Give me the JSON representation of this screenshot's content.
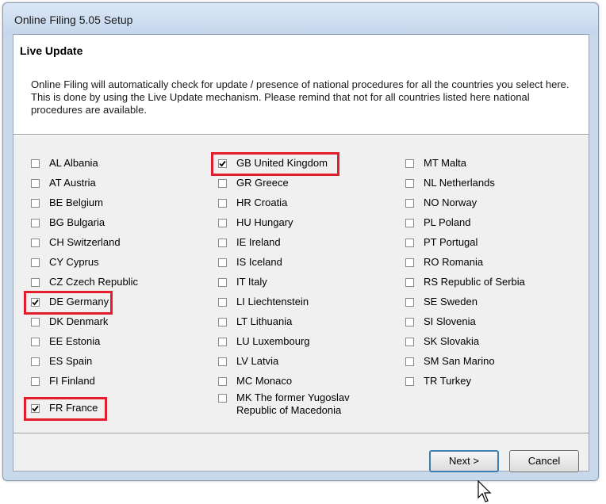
{
  "window": {
    "title": "Online Filing 5.05 Setup"
  },
  "header": {
    "title": "Live Update",
    "description": "Online Filing will automatically check for update / presence of national procedures for all the countries you select here. This is done by using the Live Update mechanism. Please remind that not for all countries listed here national procedures are available."
  },
  "countries": {
    "col1": [
      {
        "label": "AL Albania",
        "checked": false
      },
      {
        "label": "AT Austria",
        "checked": false
      },
      {
        "label": "BE Belgium",
        "checked": false
      },
      {
        "label": "BG Bulgaria",
        "checked": false
      },
      {
        "label": "CH Switzerland",
        "checked": false
      },
      {
        "label": "CY Cyprus",
        "checked": false
      },
      {
        "label": "CZ Czech Republic",
        "checked": false
      },
      {
        "label": "DE Germany",
        "checked": true
      },
      {
        "label": "DK Denmark",
        "checked": false
      },
      {
        "label": "EE Estonia",
        "checked": false
      },
      {
        "label": "ES Spain",
        "checked": false
      },
      {
        "label": "FI Finland",
        "checked": false
      },
      {
        "label": "FR France",
        "checked": true
      }
    ],
    "col2": [
      {
        "label": "GB United Kingdom",
        "checked": true
      },
      {
        "label": "GR Greece",
        "checked": false
      },
      {
        "label": "HR Croatia",
        "checked": false
      },
      {
        "label": "HU Hungary",
        "checked": false
      },
      {
        "label": "IE Ireland",
        "checked": false
      },
      {
        "label": "IS Iceland",
        "checked": false
      },
      {
        "label": "IT Italy",
        "checked": false
      },
      {
        "label": "LI Liechtenstein",
        "checked": false
      },
      {
        "label": "LT Lithuania",
        "checked": false
      },
      {
        "label": "LU Luxembourg",
        "checked": false
      },
      {
        "label": "LV Latvia",
        "checked": false
      },
      {
        "label": "MC Monaco",
        "checked": false
      },
      {
        "label": "MK The former Yugoslav Republic of Macedonia",
        "checked": false
      }
    ],
    "col3": [
      {
        "label": "MT Malta",
        "checked": false
      },
      {
        "label": "NL Netherlands",
        "checked": false
      },
      {
        "label": "NO Norway",
        "checked": false
      },
      {
        "label": "PL Poland",
        "checked": false
      },
      {
        "label": "PT Portugal",
        "checked": false
      },
      {
        "label": "RO Romania",
        "checked": false
      },
      {
        "label": "RS Republic of Serbia",
        "checked": false
      },
      {
        "label": "SE Sweden",
        "checked": false
      },
      {
        "label": "SI Slovenia",
        "checked": false
      },
      {
        "label": "SK Slovakia",
        "checked": false
      },
      {
        "label": "SM San Marino",
        "checked": false
      },
      {
        "label": "TR Turkey",
        "checked": false
      }
    ]
  },
  "buttons": {
    "next": "Next >",
    "cancel": "Cancel"
  },
  "colors": {
    "highlight": "#e31d2b",
    "checkbox_border": "#8a8a8a"
  },
  "icons": {
    "checkmark": "checkmark-icon",
    "cursor": "mouse-cursor-icon"
  }
}
